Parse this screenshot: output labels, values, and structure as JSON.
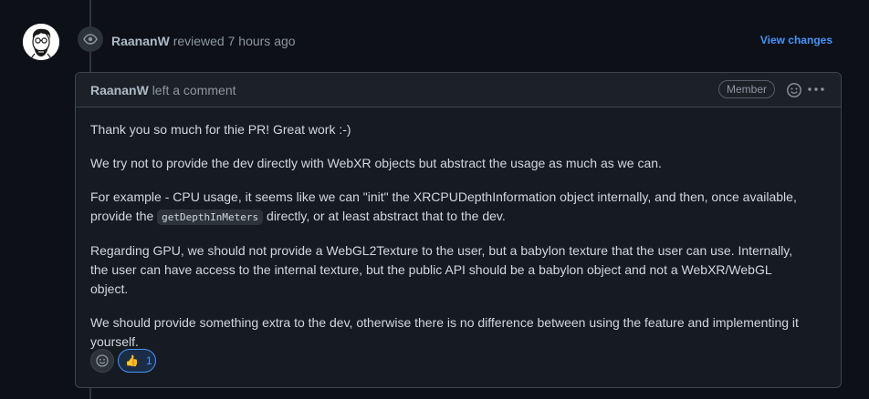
{
  "event": {
    "author": "RaananW",
    "action": "reviewed 7 hours ago",
    "view_changes_label": "View changes",
    "event_icon": "eye-icon"
  },
  "comment": {
    "author": "RaananW",
    "action": "left a comment",
    "role_badge": "Member",
    "paragraphs": {
      "p1": "Thank you so much for thie PR! Great work :-)",
      "p2": "We try not to provide the dev directly with WebXR objects but abstract the usage as much as we can.",
      "p3_before": "For example - CPU usage, it seems like we can \"init\" the XRCPUDepthInformation object internally, and then, once available, provide the ",
      "p3_code": "getDepthInMeters",
      "p3_after": " directly, or at least abstract that to the dev.",
      "p4": "Regarding GPU, we should not provide a WebGL2Texture to the user, but a babylon texture that the user can use. Internally, the user can have access to the internal texture, but the public API should be a babylon object and not a WebXR/WebGL object.",
      "p5": "We should provide something extra to the dev, otherwise there is no difference between using the feature and implementing it yourself."
    },
    "reactions": [
      {
        "emoji": "👍",
        "count": "1",
        "icon": "thumbs-up-icon"
      }
    ]
  },
  "colors": {
    "background": "#0d1117",
    "link": "#4493f8",
    "border": "#3d444d",
    "text": "#d1d7e0",
    "muted": "#8d96a0"
  }
}
